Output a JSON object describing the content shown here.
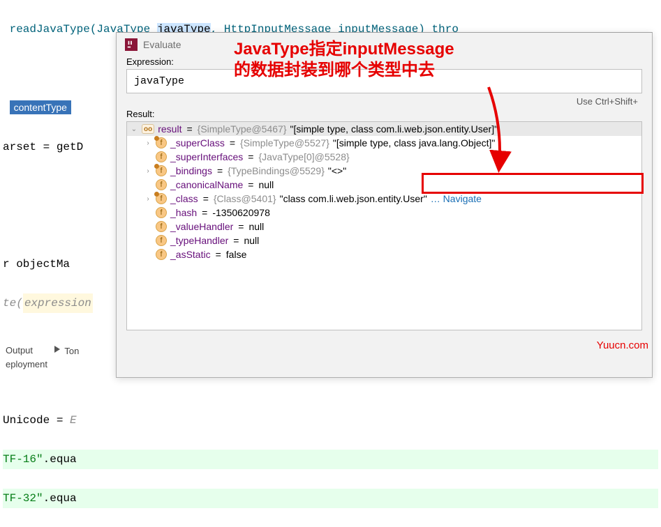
{
  "code": {
    "line1_pre": " readJavaType(JavaType ",
    "line1_hl": "javaType",
    "line1_post": ", HttpInputMessage inputMessage) thro",
    "line2_label": "contentType",
    "line3": "arset = getD",
    "line5": "r objectMa",
    "line6_pre": "te(",
    "line6_expr": "expression",
    "line8_pre": "Unicode = ",
    "line8_val": "E",
    "line9_pre": "TF-16\"",
    "line9_method": ".equa",
    "line10_pre": "TF-32\"",
    "line10_method": ".equa"
  },
  "popup": {
    "title": "Evaluate",
    "expression_label": "Expression:",
    "expression_value": "javaType",
    "hint": "Use Ctrl+Shift+",
    "result_label": "Result:"
  },
  "annotation": {
    "text_line1": "JavaType指定inputMessage",
    "text_line2": "的数据封装到哪个类型中去"
  },
  "watermark": "Yuucn.com",
  "tree": {
    "root": {
      "name": "result",
      "type": "{SimpleType@5467}",
      "value": "\"[simple type, class com.li.web.json.entity.User]\""
    },
    "items": [
      {
        "expand": true,
        "name": "_superClass",
        "type": "{SimpleType@5527}",
        "value": "\"[simple type, class java.lang.Object]\""
      },
      {
        "expand": false,
        "name": "_superInterfaces",
        "type": "{JavaType[0]@5528}",
        "value": ""
      },
      {
        "expand": true,
        "name": "_bindings",
        "type": "{TypeBindings@5529}",
        "value": "\"<>\""
      },
      {
        "expand": false,
        "name": "_canonicalName",
        "type": "",
        "value": "null"
      },
      {
        "expand": true,
        "name": "_class",
        "type": "{Class@5401}",
        "value": "\"class com.li.web.json.entity.User\"",
        "link": "… Navigate"
      },
      {
        "expand": false,
        "name": "_hash",
        "type": "",
        "value": "-1350620978"
      },
      {
        "expand": false,
        "name": "_valueHandler",
        "type": "",
        "value": "null"
      },
      {
        "expand": false,
        "name": "_typeHandler",
        "type": "",
        "value": "null"
      },
      {
        "expand": false,
        "name": "_asStatic",
        "type": "",
        "value": "false"
      }
    ]
  },
  "bottom": {
    "output": "Output",
    "ton": "Ton",
    "eployment": "eployment"
  }
}
